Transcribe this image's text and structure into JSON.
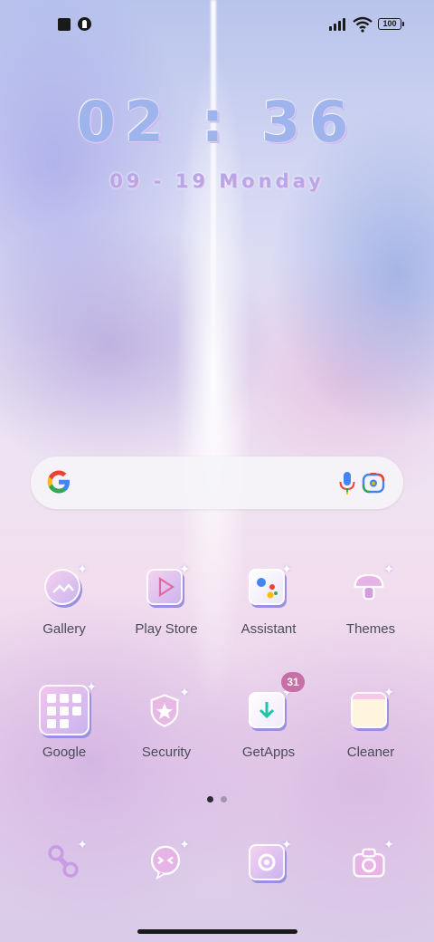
{
  "status_bar": {
    "battery": "100",
    "icons": [
      "stop-square-icon",
      "brightness-icon",
      "signal-icon",
      "wifi-icon",
      "battery-icon"
    ]
  },
  "clock": {
    "time": "02 : 36",
    "date": "09 - 19  Monday"
  },
  "search_bar": {
    "icons": [
      "google-logo-icon",
      "microphone-icon",
      "google-lens-icon"
    ]
  },
  "apps_row1": [
    {
      "label": "Gallery",
      "icon": "gallery-icon"
    },
    {
      "label": "Play Store",
      "icon": "play-store-icon"
    },
    {
      "label": "Assistant",
      "icon": "assistant-icon"
    },
    {
      "label": "Themes",
      "icon": "themes-icon"
    }
  ],
  "apps_row2": [
    {
      "label": "Google",
      "icon": "google-folder-icon"
    },
    {
      "label": "Security",
      "icon": "security-icon"
    },
    {
      "label": "GetApps",
      "icon": "getapps-icon",
      "badge": "31"
    },
    {
      "label": "Cleaner",
      "icon": "cleaner-icon"
    }
  ],
  "dock": [
    {
      "icon": "phone-icon"
    },
    {
      "icon": "messages-icon"
    },
    {
      "icon": "browser-icon"
    },
    {
      "icon": "camera-icon"
    }
  ],
  "pager": {
    "pages": 2,
    "current": 1
  },
  "colors": {
    "badge": "#c770a6",
    "clock_text": "#9fb4ec",
    "date_text": "#b7a6e8",
    "label_text": "#4b4b57"
  }
}
